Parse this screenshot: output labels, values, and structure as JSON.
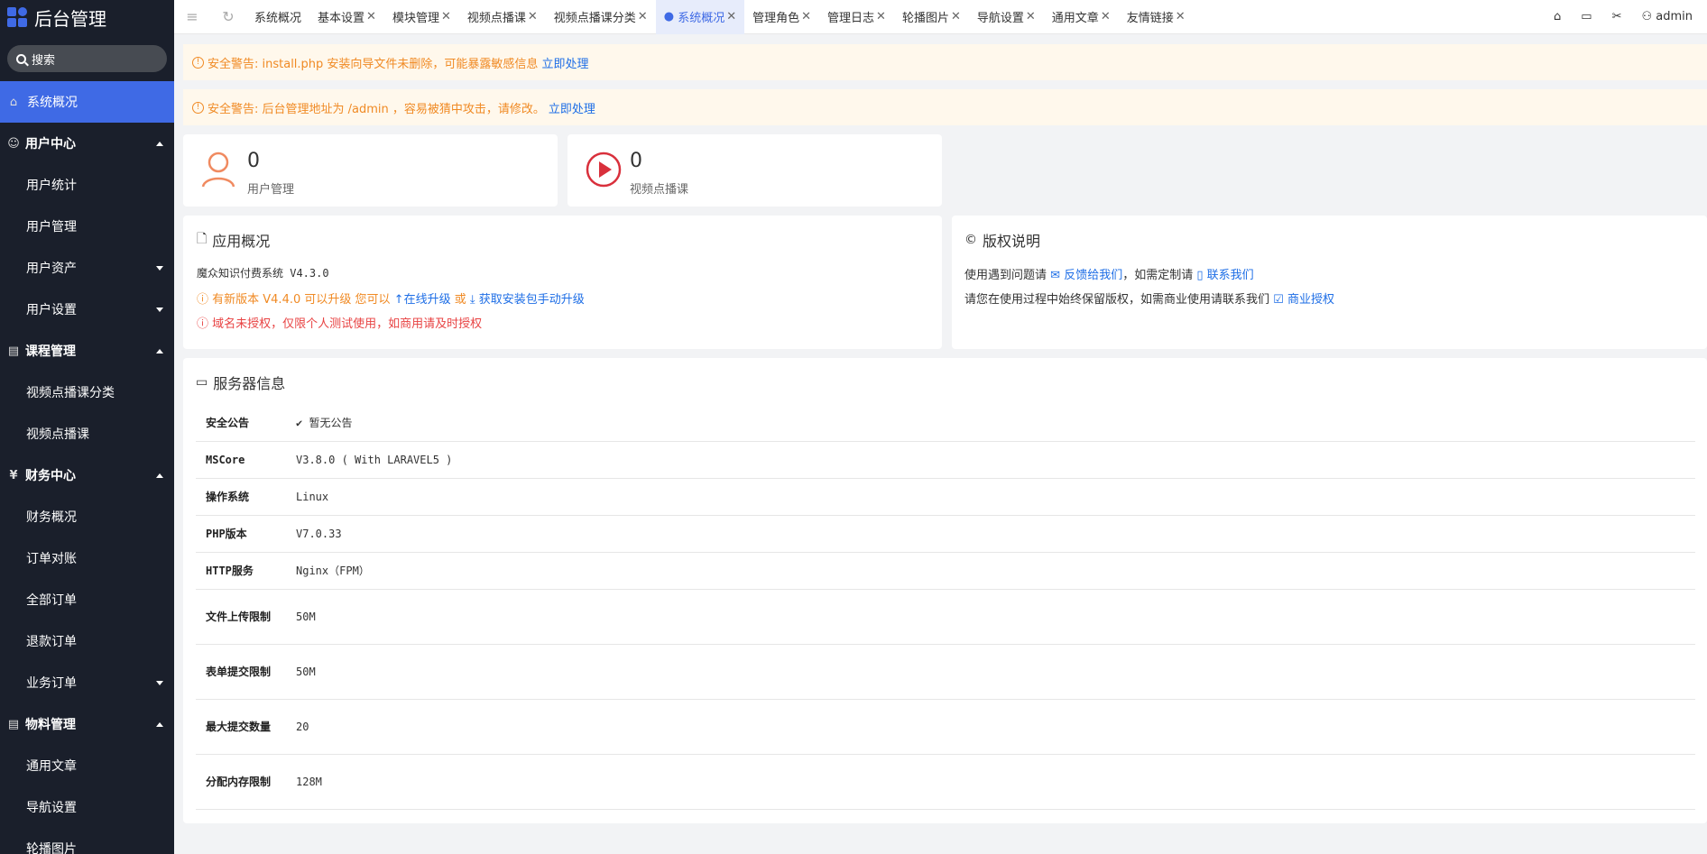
{
  "app": {
    "title": "后台管理",
    "search_label": "搜索"
  },
  "sidebar": {
    "active": "系统概况",
    "groups": [
      {
        "label": "用户中心",
        "items": [
          "用户统计",
          "用户管理",
          "用户资产",
          "用户设置"
        ]
      },
      {
        "label": "课程管理",
        "items": [
          "视频点播课分类",
          "视频点播课"
        ]
      },
      {
        "label": "财务中心",
        "items": [
          "财务概况",
          "订单对账",
          "全部订单",
          "退款订单",
          "业务订单"
        ]
      },
      {
        "label": "物料管理",
        "items": [
          "通用文章",
          "导航设置",
          "轮播图片"
        ]
      }
    ]
  },
  "tabs": [
    "系统概况",
    "基本设置",
    "模块管理",
    "视频点播课",
    "视频点播课分类",
    "系统概况",
    "管理角色",
    "管理日志",
    "轮播图片",
    "导航设置",
    "通用文章",
    "友情链接"
  ],
  "top_right": {
    "user": "admin"
  },
  "alerts": [
    {
      "text": "安全警告: install.php 安装向导文件未删除，可能暴露敏感信息",
      "link": "立即处理"
    },
    {
      "text": "安全警告: 后台管理地址为 /admin ，容易被猜中攻击，请修改。",
      "link": "立即处理"
    }
  ],
  "stats": [
    {
      "value": "0",
      "label": "用户管理"
    },
    {
      "value": "0",
      "label": "视频点播课"
    }
  ],
  "app_overview": {
    "title": "应用概况",
    "version_line": "魔众知识付费系统 V4.3.0",
    "upgrade_prefix": "有新版本 V4.4.0 可以升级 您可以",
    "upgrade_online": "在线升级",
    "upgrade_or": "或",
    "upgrade_manual": "获取安装包手动升级",
    "license_warning": "域名未授权，仅限个人测试使用，如商用请及时授权"
  },
  "copyright": {
    "title": "版权说明",
    "line1_prefix": "使用遇到问题请",
    "feedback": "反馈给我们",
    "line1_mid": "，如需定制请",
    "contact": "联系我们",
    "line2_prefix": "请您在使用过程中始终保留版权，如需商业使用请联系我们",
    "license": "商业授权"
  },
  "server": {
    "title": "服务器信息",
    "rows": [
      {
        "k": "安全公告",
        "v": "暂无公告"
      },
      {
        "k": "MSCore",
        "v": "V3.8.0 ( With LARAVEL5 )"
      },
      {
        "k": "操作系统",
        "v": "Linux"
      },
      {
        "k": "PHP版本",
        "v": "V7.0.33"
      },
      {
        "k": "HTTP服务",
        "v": "Nginx（FPM）"
      },
      {
        "k": "文件上传限制",
        "v": "50M"
      },
      {
        "k": "表单提交限制",
        "v": "50M"
      },
      {
        "k": "最大提交数量",
        "v": "20"
      },
      {
        "k": "分配内存限制",
        "v": "128M"
      }
    ]
  },
  "colors": {
    "accent": "#3f6ae5",
    "sidebar_bg": "#1a1f2b",
    "warning": "#f08a24",
    "danger": "#e84343",
    "link": "#1e6ee6"
  }
}
